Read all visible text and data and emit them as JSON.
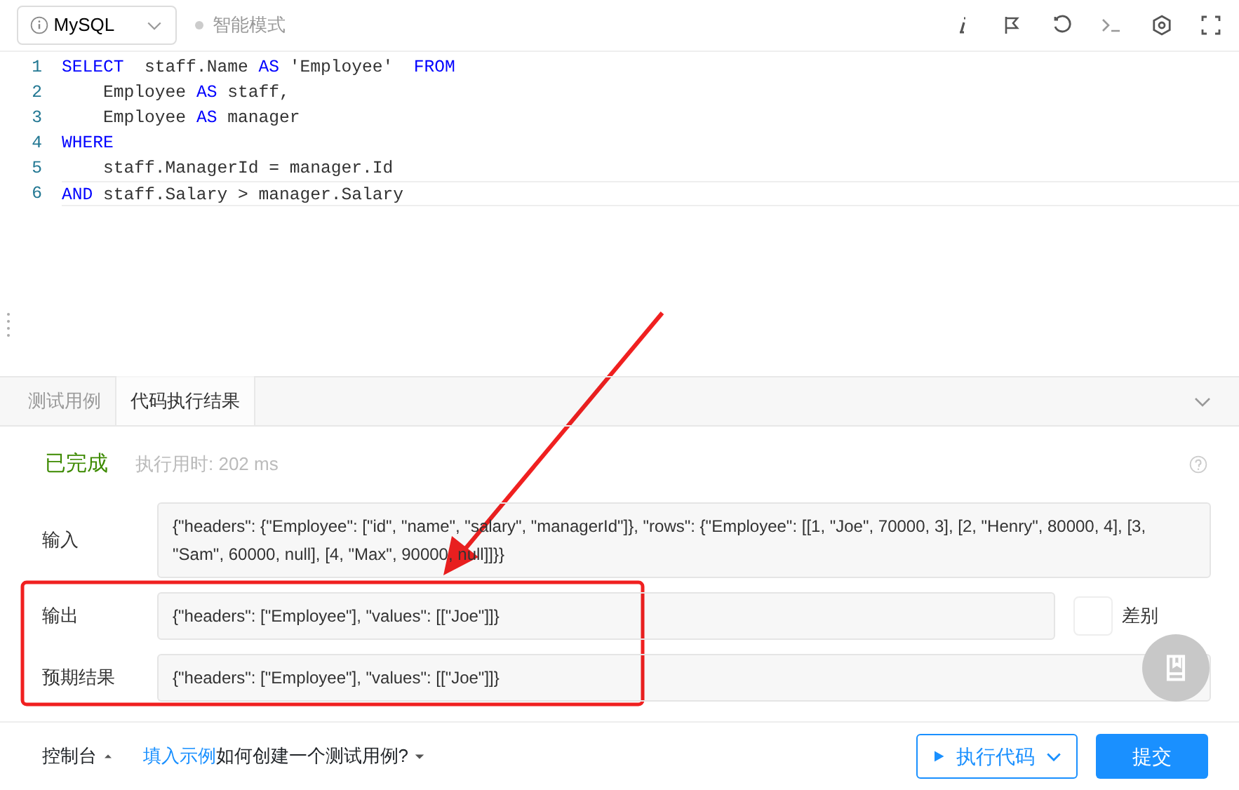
{
  "toolbar": {
    "language": "MySQL",
    "mode": {
      "label": "智能模式",
      "on": false
    }
  },
  "editor": {
    "lines": [
      {
        "number": "1",
        "current": false,
        "tokens": [
          {
            "kind": "keyword",
            "text": "SELECT"
          },
          {
            "kind": "plain",
            "text": "  staff.Name "
          },
          {
            "kind": "keyword",
            "text": "AS"
          },
          {
            "kind": "plain",
            "text": " 'Employee'  "
          },
          {
            "kind": "keyword",
            "text": "FROM"
          }
        ]
      },
      {
        "number": "2",
        "current": false,
        "tokens": [
          {
            "kind": "plain",
            "text": "    Employee "
          },
          {
            "kind": "keyword",
            "text": "AS"
          },
          {
            "kind": "plain",
            "text": " staff,"
          }
        ]
      },
      {
        "number": "3",
        "current": false,
        "tokens": [
          {
            "kind": "plain",
            "text": "    Employee "
          },
          {
            "kind": "keyword",
            "text": "AS"
          },
          {
            "kind": "plain",
            "text": " manager"
          }
        ]
      },
      {
        "number": "4",
        "current": false,
        "tokens": [
          {
            "kind": "keyword",
            "text": "WHERE"
          }
        ]
      },
      {
        "number": "5",
        "current": false,
        "tokens": [
          {
            "kind": "plain",
            "text": "    staff.ManagerId = manager.Id"
          }
        ]
      },
      {
        "number": "6",
        "current": true,
        "tokens": [
          {
            "kind": "keyword",
            "text": "AND"
          },
          {
            "kind": "plain",
            "text": " staff.Salary > manager.Salary"
          }
        ]
      }
    ]
  },
  "tabs": [
    {
      "label": "测试用例",
      "selected": false
    },
    {
      "label": "代码执行结果",
      "selected": true
    }
  ],
  "result": {
    "status": "已完成",
    "runtime": "执行用时: 202 ms",
    "rows": [
      {
        "label": "输入",
        "value": "{\"headers\": {\"Employee\": [\"id\", \"name\", \"salary\", \"managerId\"]}, \"rows\": {\"Employee\": [[1, \"Joe\", 70000, 3], [2, \"Henry\", 80000, 4], [3, \"Sam\", 60000, null], [4, \"Max\", 90000, null]]}}",
        "diff": null
      },
      {
        "label": "输出",
        "value": "{\"headers\": [\"Employee\"], \"values\": [[\"Joe\"]]}",
        "diff": {
          "label": "差别",
          "on": false
        }
      },
      {
        "label": "预期结果",
        "value": "{\"headers\": [\"Employee\"], \"values\": [[\"Joe\"]]}",
        "diff": null
      }
    ]
  },
  "footer": {
    "console": "控制台",
    "fill_example": "填入示例",
    "help": "如何创建一个测试用例?",
    "run": "执行代码",
    "submit": "提交"
  },
  "annotations": {
    "arrow": true,
    "frame": true
  }
}
